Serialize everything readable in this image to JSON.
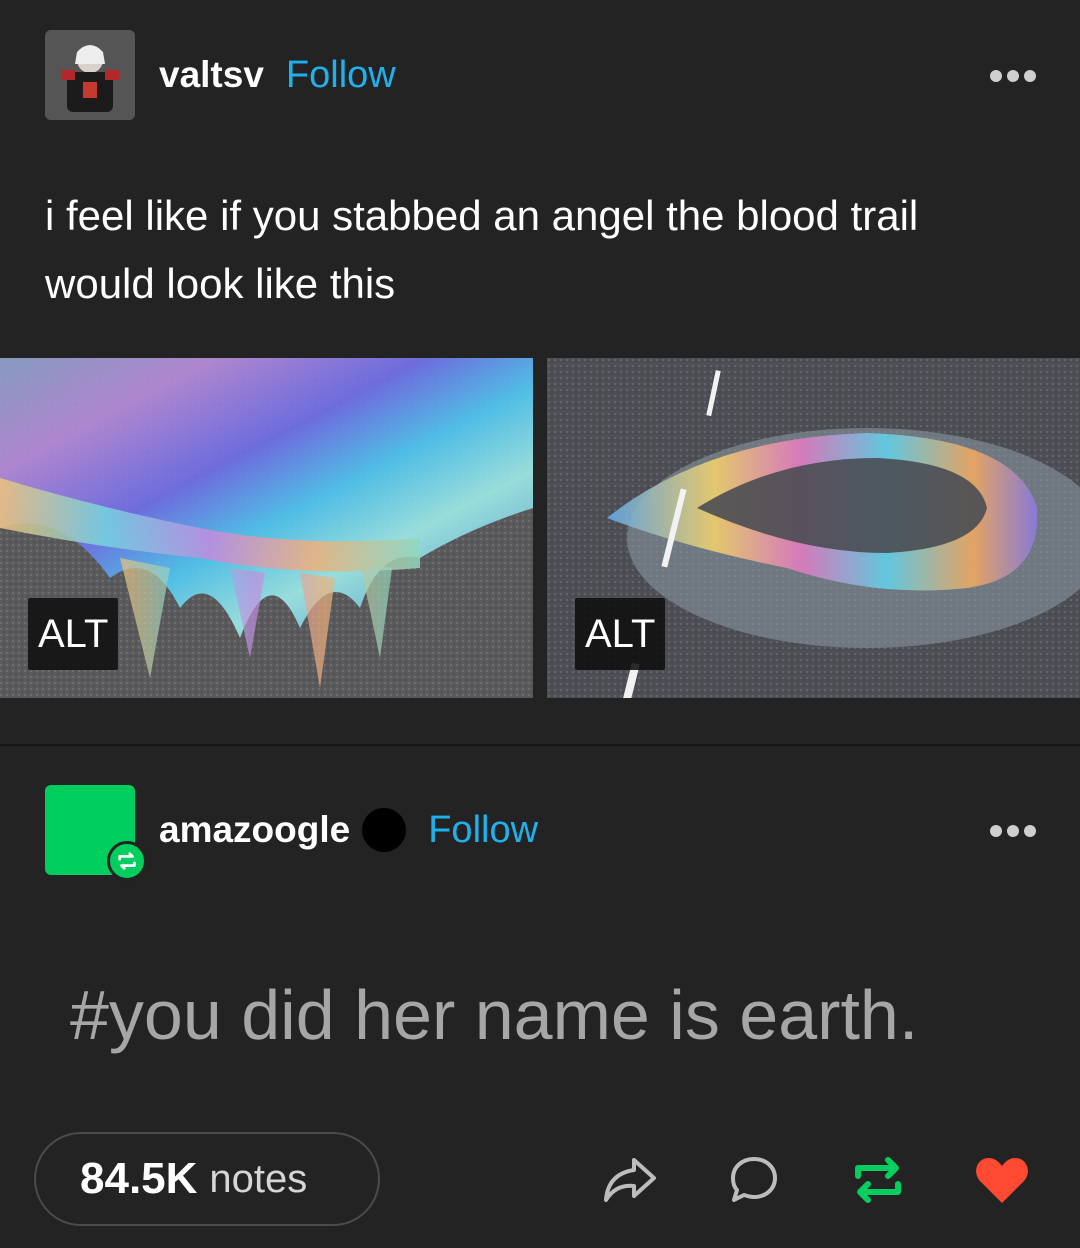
{
  "post": {
    "author": "valtsv",
    "follow_label": "Follow",
    "text": "i feel like if you stabbed an angel the blood trail would look like this",
    "images": [
      {
        "alt_badge": "ALT",
        "subject": "oil slick rainbow on asphalt"
      },
      {
        "alt_badge": "ALT",
        "subject": "oil spill rainbow ring on road with lane marking"
      }
    ]
  },
  "reblog": {
    "author": "amazoogle",
    "follow_label": "Follow",
    "tag": "#you did her name is earth."
  },
  "footer": {
    "notes_count": "84.5K",
    "notes_label": "notes",
    "icons": [
      "share-icon",
      "reply-icon",
      "reblog-icon",
      "like-icon"
    ]
  },
  "colors": {
    "background": "#232323",
    "follow_blue": "#1eb1ee",
    "reblog_green": "#00cf5f",
    "like_red": "#ff4930",
    "tag_gray": "#a6a6a6"
  }
}
